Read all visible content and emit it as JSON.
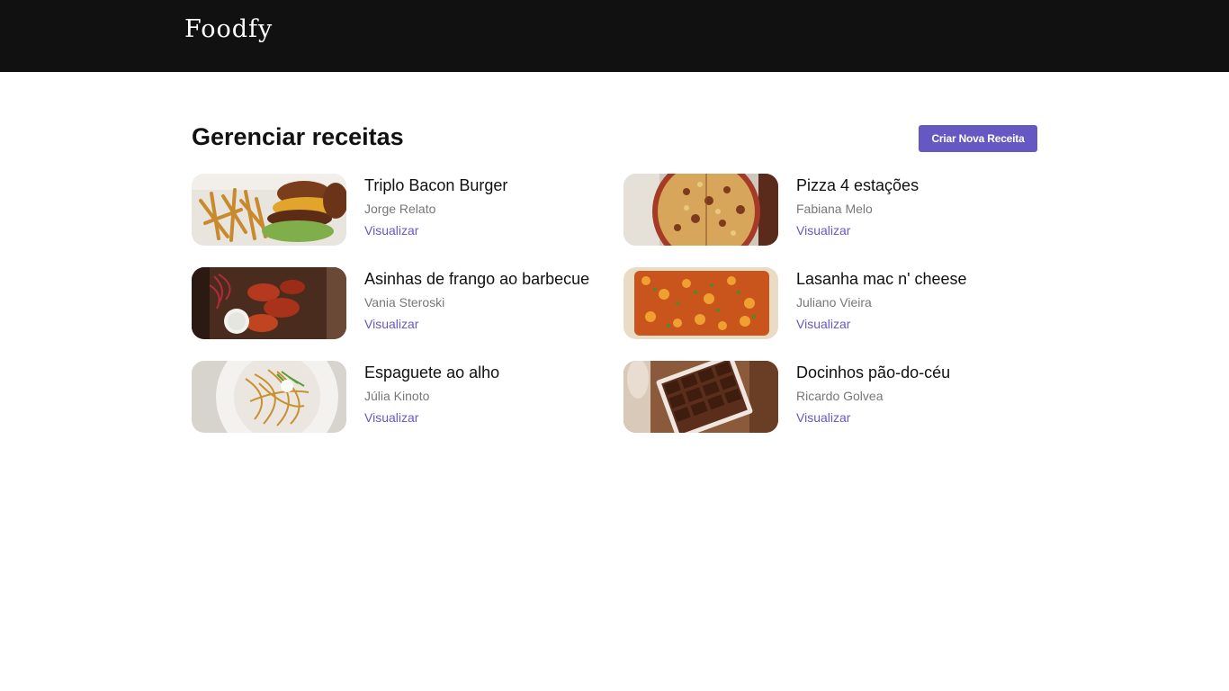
{
  "header": {
    "logo": "Foodfy"
  },
  "main": {
    "title": "Gerenciar receitas",
    "create_button_label": "Criar Nova Receita",
    "recipes": [
      {
        "title": "Triplo Bacon Burger",
        "author": "Jorge Relato",
        "link_label": "Visualizar",
        "image": "burger-with-fries"
      },
      {
        "title": "Pizza 4 estações",
        "author": "Fabiana Melo",
        "link_label": "Visualizar",
        "image": "pizza"
      },
      {
        "title": "Asinhas de frango ao barbecue",
        "author": "Vania Steroski",
        "link_label": "Visualizar",
        "image": "bbq-chicken-wings"
      },
      {
        "title": "Lasanha mac n' cheese",
        "author": "Juliano Vieira",
        "link_label": "Visualizar",
        "image": "lasagna"
      },
      {
        "title": "Espaguete ao alho",
        "author": "Júlia Kinoto",
        "link_label": "Visualizar",
        "image": "spaghetti-plate"
      },
      {
        "title": "Docinhos pão-do-céu",
        "author": "Ricardo Golvea",
        "link_label": "Visualizar",
        "image": "chocolate-sweets-box"
      }
    ]
  },
  "colors": {
    "header_bg": "#111111",
    "accent": "#6558c3",
    "title_text": "#111111",
    "muted_text": "#777777"
  }
}
